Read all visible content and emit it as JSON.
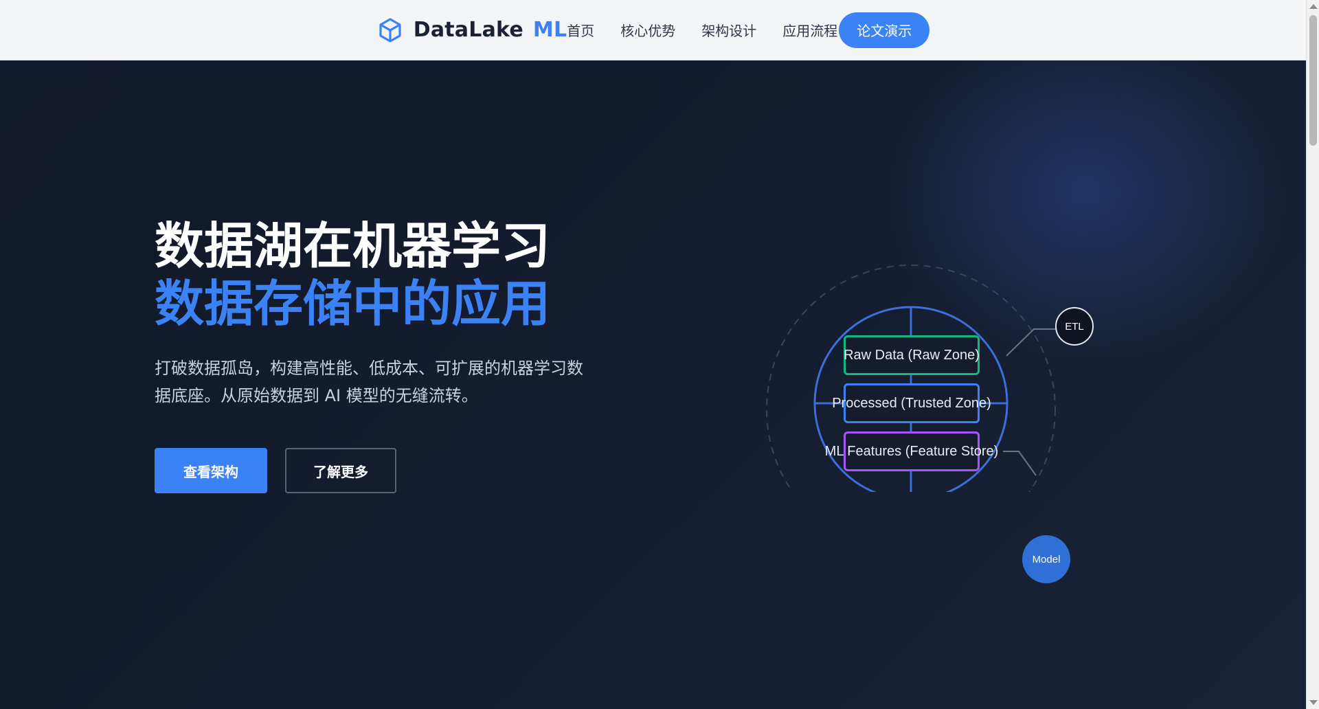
{
  "brand": {
    "name": "DataLake",
    "suffix": "ML",
    "icon": "cube-icon"
  },
  "nav": {
    "links": [
      "首页",
      "核心优势",
      "架构设计",
      "应用流程"
    ],
    "cta": "论文演示"
  },
  "hero": {
    "title_line1": "数据湖在机器学习",
    "title_line2": "数据存储中的应用",
    "description": "打破数据孤岛，构建高性能、低成本、可扩展的机器学习数据底座。从原始数据到 AI 模型的无缝流转。",
    "primary_button": "查看架构",
    "secondary_button": "了解更多"
  },
  "diagram": {
    "zones": [
      {
        "label": "Raw Data (Raw Zone)",
        "color": "#10b981"
      },
      {
        "label": "Processed (Trusted Zone)",
        "color": "#3b82f6"
      },
      {
        "label": "ML Features (Feature Store)",
        "color": "#a855f7"
      }
    ],
    "badges": {
      "etl": "ETL",
      "model": "Model"
    }
  },
  "colors": {
    "accent": "#3b82f6",
    "hero_bg": "#131b2e",
    "navbar_bg": "#f4f5f7"
  }
}
